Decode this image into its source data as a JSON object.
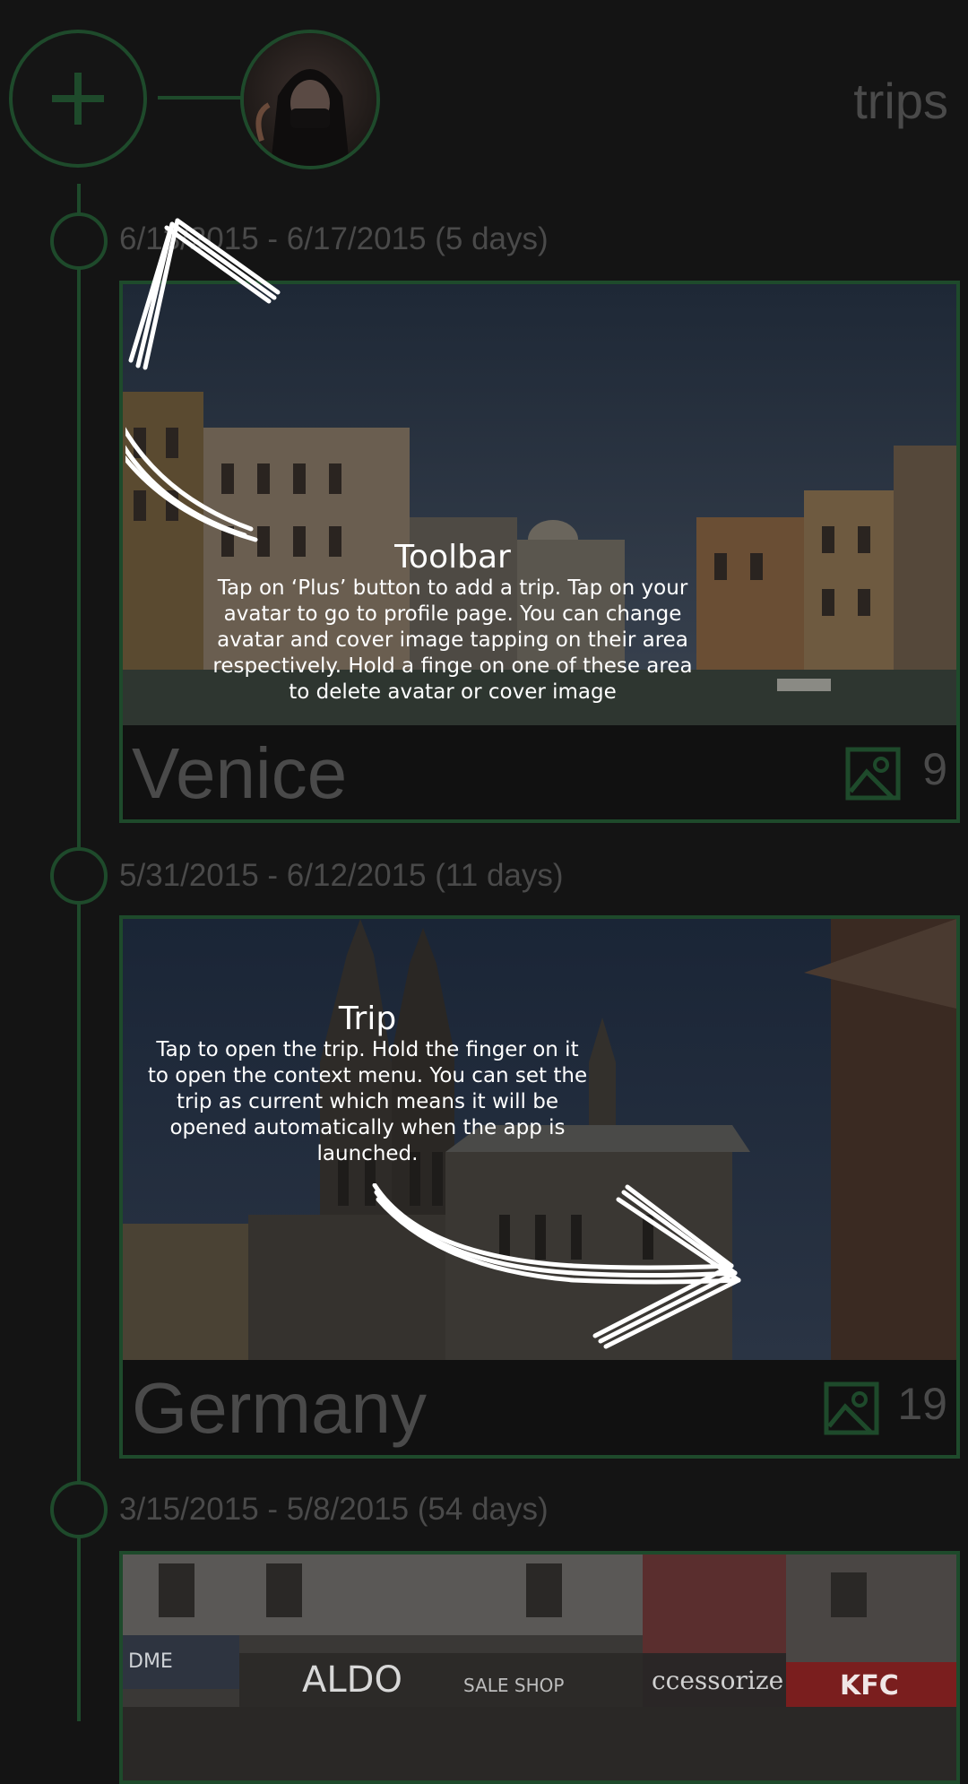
{
  "toolbar": {
    "title": "trips",
    "add_icon": "plus-icon",
    "avatar_icon": "avatar-image"
  },
  "trips": [
    {
      "dates": "6/13/2015 - 6/17/2015 (5 days)",
      "name": "Venice",
      "photo_count": "9",
      "photo_icon": "image-icon"
    },
    {
      "dates": "5/31/2015 - 6/12/2015 (11 days)",
      "name": "Germany",
      "photo_count": "19",
      "photo_icon": "image-icon"
    },
    {
      "dates": "3/15/2015 - 5/8/2015 (54 days)",
      "name": "",
      "photo_count": "",
      "photo_icon": "image-icon"
    }
  ],
  "coach_tips": {
    "toolbar": {
      "title": "Toolbar",
      "text": "Tap on ‘Plus’ button to add a trip. Tap on your\navatar to go to profile page. You can change\navatar and cover image tapping on their area\nrespectively. Hold a finge on one of these area\nto delete avatar or cover image"
    },
    "trip": {
      "title": "Trip",
      "text": "Tap to open the trip. Hold the finger on it\nto open the context menu. You can set the\ntrip as current which means it will be\nopened automatically when the app is\nlaunched."
    }
  },
  "third_photo_signs": {
    "sign1": "DME",
    "sign2": "ALDO",
    "sign3": "SALE SHOP",
    "sign4": "ccessorize",
    "sign5": "KFC"
  },
  "colors": {
    "accent": "#1e4a2b",
    "background": "#141414",
    "muted_text": "#4a4a4a",
    "overlay_text": "#ffffff"
  }
}
